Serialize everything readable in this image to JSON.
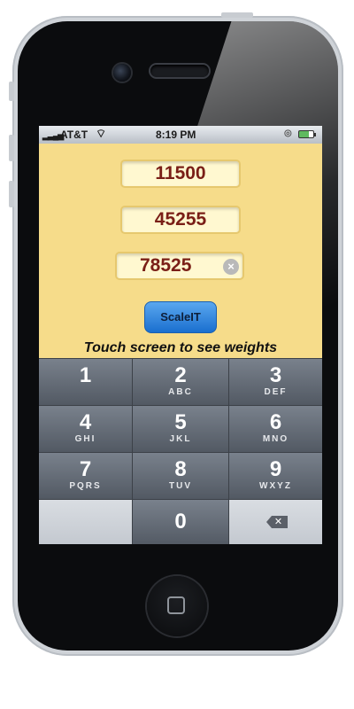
{
  "status_bar": {
    "carrier": "AT&T",
    "time": "8:19 PM",
    "signal_icon": "signal-bars-icon",
    "wifi_icon": "wifi-icon",
    "lock_icon": "orientation-lock-icon",
    "battery_icon": "battery-icon"
  },
  "fields": {
    "field1_value": "11500",
    "field2_value": "45255",
    "field3_value": "78525"
  },
  "scale_button_label": "ScaleIT",
  "hint_text": "Touch screen to see weights",
  "keypad": {
    "keys": [
      {
        "digit": "1",
        "letters": ""
      },
      {
        "digit": "2",
        "letters": "ABC"
      },
      {
        "digit": "3",
        "letters": "DEF"
      },
      {
        "digit": "4",
        "letters": "GHI"
      },
      {
        "digit": "5",
        "letters": "JKL"
      },
      {
        "digit": "6",
        "letters": "MNO"
      },
      {
        "digit": "7",
        "letters": "PQRS"
      },
      {
        "digit": "8",
        "letters": "TUV"
      },
      {
        "digit": "9",
        "letters": "WXYZ"
      },
      {
        "digit": "",
        "letters": ""
      },
      {
        "digit": "0",
        "letters": ""
      },
      {
        "digit": "",
        "letters": ""
      }
    ],
    "delete_icon": "backspace-icon"
  },
  "colors": {
    "screen_background": "#f6dc8a",
    "field_text": "#7a1f17",
    "button_blue": "#1a6fcf"
  }
}
